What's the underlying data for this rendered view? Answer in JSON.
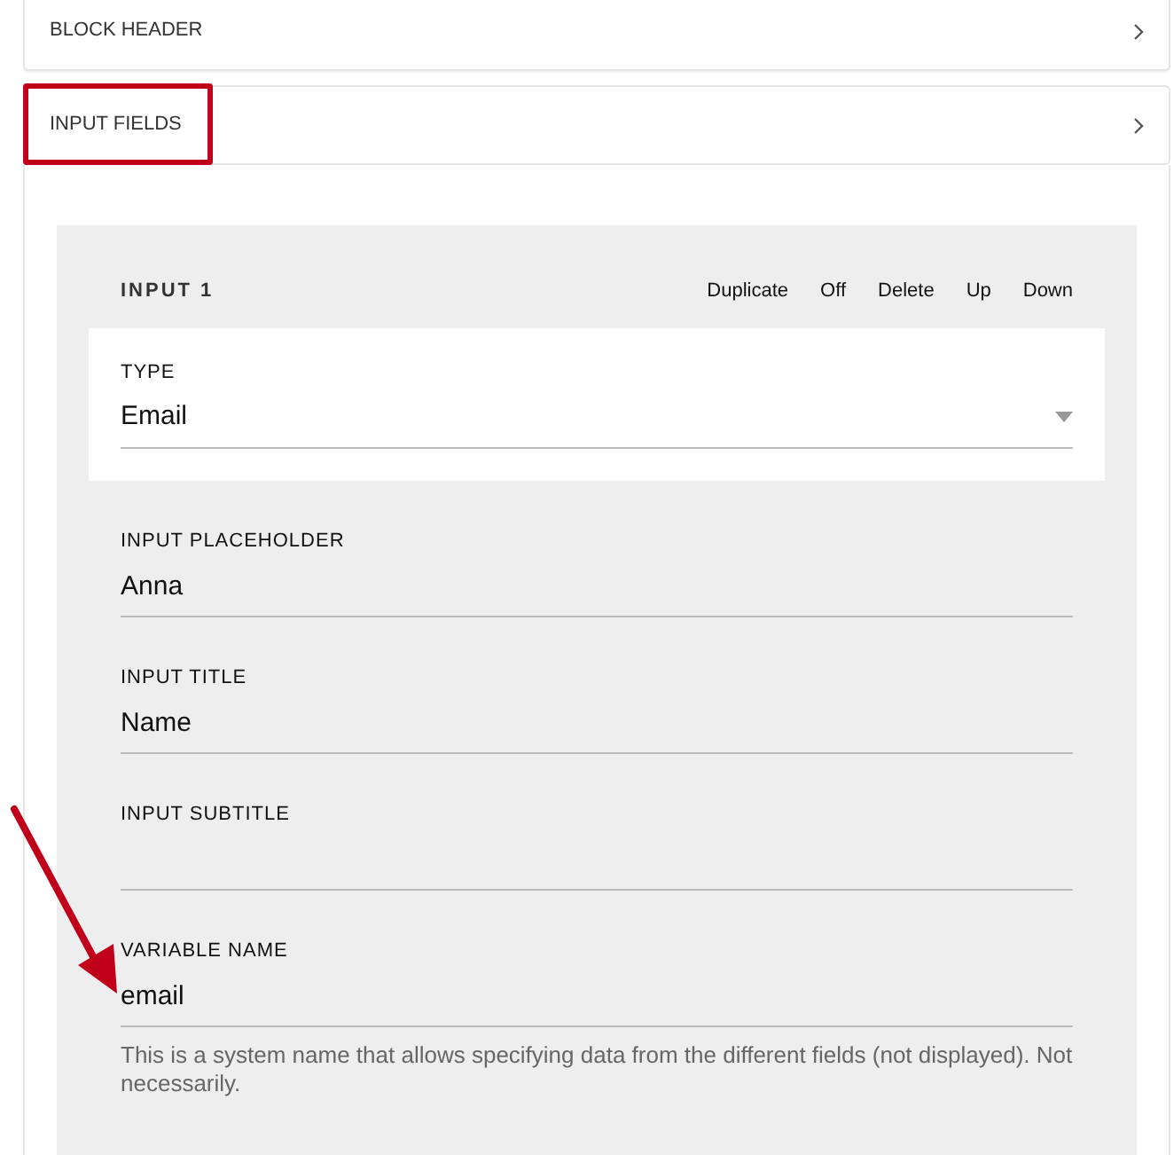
{
  "sections": [
    {
      "title": "BLOCK HEADER",
      "expanded": false
    },
    {
      "title": "INPUT FIELDS",
      "expanded": true
    }
  ],
  "input": {
    "title": "INPUT 1",
    "actions": [
      "Duplicate",
      "Off",
      "Delete",
      "Up",
      "Down"
    ],
    "fields": [
      {
        "kind": "select",
        "label": "TYPE",
        "value": "Email"
      },
      {
        "kind": "text",
        "label": "INPUT PLACEHOLDER",
        "value": "Anna"
      },
      {
        "kind": "text",
        "label": "INPUT TITLE",
        "value": "Name"
      },
      {
        "kind": "text",
        "label": "INPUT SUBTITLE"
      },
      {
        "kind": "text",
        "label": "VARIABLE NAME",
        "value": "email",
        "help": "This is a system name that allows specifying data from the different fields (not displayed). Not necessarily."
      }
    ]
  }
}
